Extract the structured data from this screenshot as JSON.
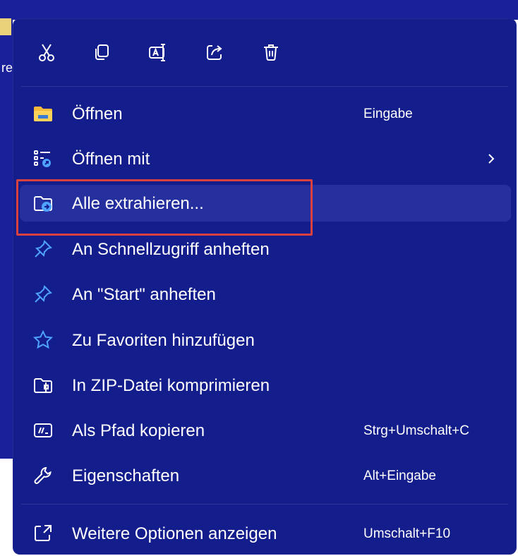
{
  "background": {
    "text": "re"
  },
  "toolbar": {
    "buttons": [
      {
        "name": "cut",
        "icon": "scissors-icon"
      },
      {
        "name": "copy",
        "icon": "copy-icon"
      },
      {
        "name": "rename",
        "icon": "rename-icon"
      },
      {
        "name": "share",
        "icon": "share-icon"
      },
      {
        "name": "delete",
        "icon": "trash-icon"
      }
    ]
  },
  "menu": {
    "items": [
      {
        "label": "Öffnen",
        "shortcut": "Eingabe",
        "icon": "folder-icon"
      },
      {
        "label": "Öffnen mit",
        "shortcut": "",
        "icon": "open-with-icon",
        "submenu": true
      },
      {
        "label": "Alle extrahieren...",
        "shortcut": "",
        "icon": "extract-folder-icon",
        "highlighted": true
      },
      {
        "label": "An Schnellzugriff anheften",
        "shortcut": "",
        "icon": "pin-icon"
      },
      {
        "label": "An \"Start\" anheften",
        "shortcut": "",
        "icon": "pin-start-icon"
      },
      {
        "label": "Zu Favoriten hinzufügen",
        "shortcut": "",
        "icon": "star-icon"
      },
      {
        "label": "In ZIP-Datei komprimieren",
        "shortcut": "",
        "icon": "zip-icon"
      },
      {
        "label": "Als Pfad kopieren",
        "shortcut": "Strg+Umschalt+C",
        "icon": "copy-path-icon"
      },
      {
        "label": "Eigenschaften",
        "shortcut": "Alt+Eingabe",
        "icon": "wrench-icon"
      },
      {
        "label": "Weitere Optionen anzeigen",
        "shortcut": "Umschalt+F10",
        "icon": "more-options-icon"
      }
    ]
  },
  "colors": {
    "menu_bg": "#141d8c",
    "hover_bg": "#25309e",
    "accent": "#4fa3ff",
    "highlight_border": "#d9413f",
    "text": "#ffffff"
  }
}
